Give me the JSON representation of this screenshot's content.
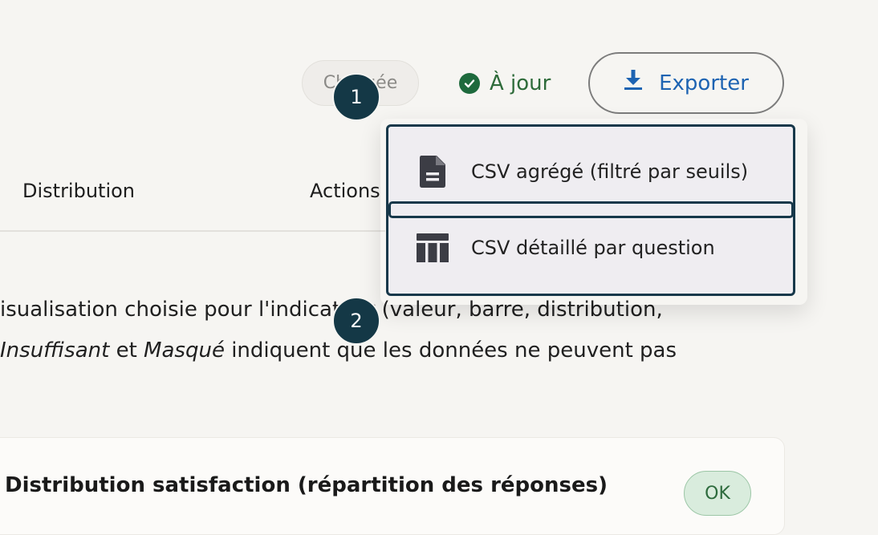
{
  "header": {
    "status_pill": "Chargée",
    "sync_status": "À jour",
    "export_label": "Exporter"
  },
  "table": {
    "columns": [
      "Distribution",
      "Actions"
    ]
  },
  "help": {
    "line1": "isualisation choisie pour l'indicateur (valeur, barre, distribution,",
    "line2_a": "Insuffisant",
    "line2_b": " et ",
    "line2_c": "Masqué",
    "line2_d": " indiquent que les données ne peuvent pas"
  },
  "card": {
    "title": "Distribution satisfaction (répartition des réponses)",
    "badge": "OK"
  },
  "export_menu": {
    "items": [
      {
        "label": "CSV agrégé (filtré par seuils)",
        "icon": "file-text-icon"
      },
      {
        "label": "CSV détaillé par question",
        "icon": "table-icon"
      }
    ]
  },
  "steps": [
    "1",
    "2"
  ],
  "colors": {
    "accent": "#1d63b2",
    "success": "#1e6a3d",
    "marker": "#143846"
  }
}
